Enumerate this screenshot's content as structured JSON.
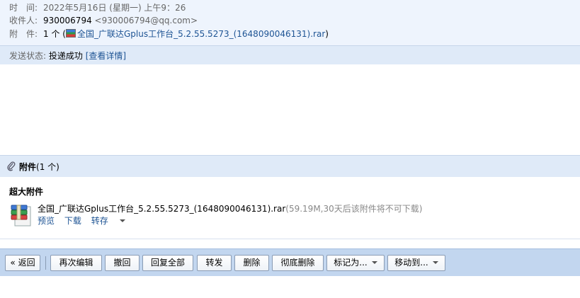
{
  "header": {
    "time_label": "时　间:",
    "time_value": "2022年5月16日 (星期一) 上午9：26",
    "recipient_label": "收件人:",
    "recipient_name": "930006794",
    "recipient_email": "<930006794@qq.com>",
    "attachment_label": "附　件:",
    "attachment_count": "1 个",
    "attachment_open": "(",
    "attachment_file": "全国_广联达Gplus工作台_5.2.55.5273_(1648090046131).rar",
    "attachment_close": ")"
  },
  "status": {
    "label": "发送状态:",
    "value": "投递成功",
    "details_link": "[查看详情]"
  },
  "attachments": {
    "title": "附件",
    "count": "(1 个)",
    "section_label": "超大附件",
    "file": {
      "name": "全国_广联达Gplus工作台_5.2.55.5273_(1648090046131).rar",
      "meta": "(59.19M,30天后该附件将不可下载)",
      "preview": "预览",
      "download": "下载",
      "save": "转存"
    }
  },
  "toolbar": {
    "back": "« 返回",
    "edit_again": "再次编辑",
    "recall": "撤回",
    "reply_all": "回复全部",
    "forward": "转发",
    "delete": "删除",
    "delete_permanently": "彻底删除",
    "mark_as": "标记为...",
    "move_to": "移动到..."
  }
}
